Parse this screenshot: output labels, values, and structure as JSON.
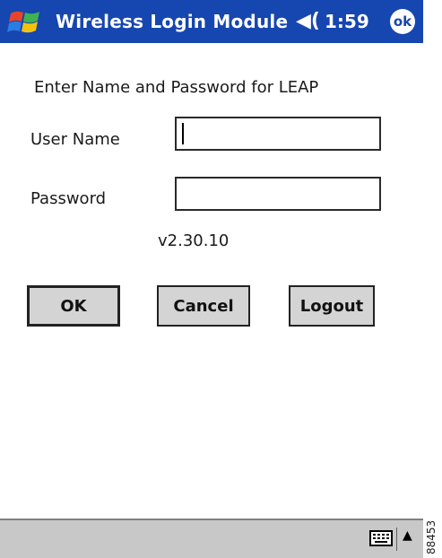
{
  "titlebar": {
    "title": "Wireless Login Module",
    "time": "1:59",
    "ok_label": "ok",
    "speaker_icon": "speaker-icon",
    "start_icon": "windows-flag-icon",
    "bg_color": "#1646b0"
  },
  "form": {
    "instruction": "Enter Name and Password for LEAP",
    "username_label": "User Name",
    "username_value": "",
    "password_label": "Password",
    "password_value": "",
    "version": "v2.30.10"
  },
  "buttons": {
    "ok": "OK",
    "cancel": "Cancel",
    "logout": "Logout"
  },
  "taskbar": {
    "keyboard_icon": "keyboard-icon",
    "arrow_icon": "up-arrow-icon"
  },
  "figure_id": "88453"
}
